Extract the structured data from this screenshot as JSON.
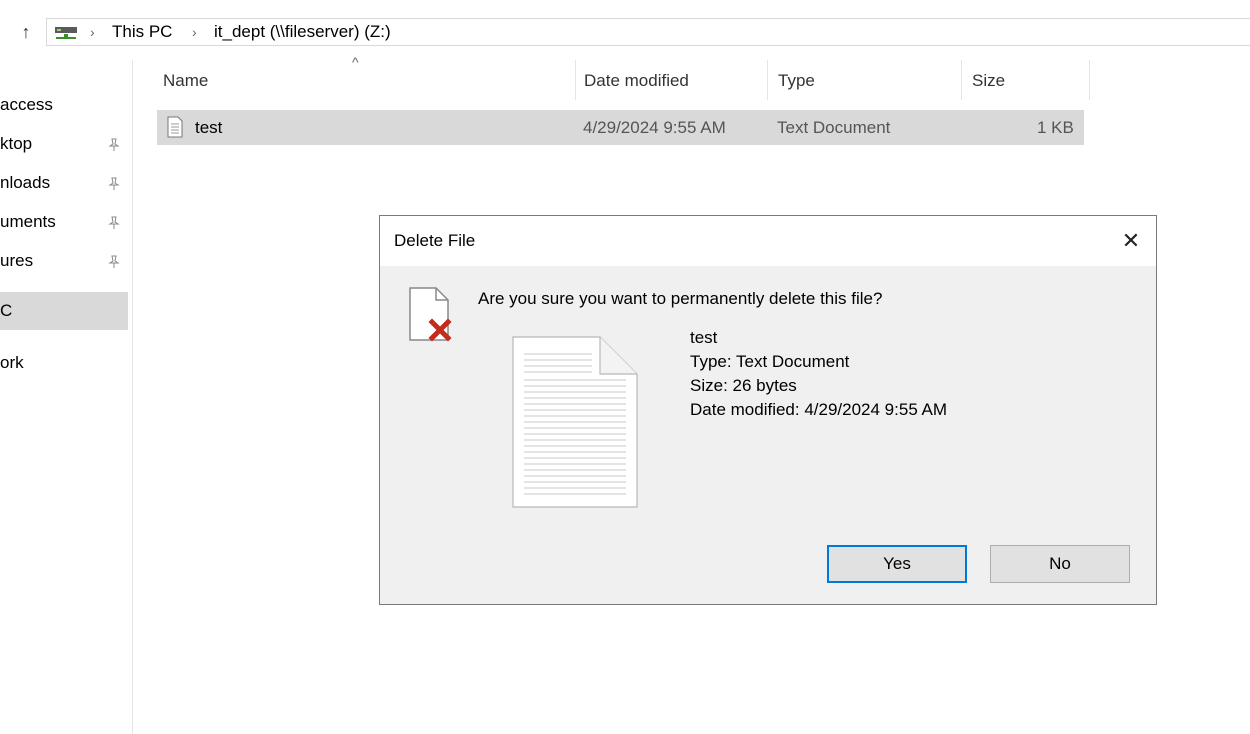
{
  "address": {
    "crumbs": [
      "This PC",
      "it_dept (\\\\fileserver) (Z:)"
    ],
    "separator": "›",
    "up_glyph": "↑"
  },
  "icons": {
    "up": "up-arrow-icon",
    "drive": "network-drive-icon",
    "pin": "pin-icon",
    "file": "text-file-icon",
    "delete": "delete-warning-icon",
    "close": "close-icon"
  },
  "sidebar": {
    "items": [
      {
        "label": "access",
        "pinned": false
      },
      {
        "label": "ktop",
        "pinned": true
      },
      {
        "label": "nloads",
        "pinned": true
      },
      {
        "label": "uments",
        "pinned": true
      },
      {
        "label": "ures",
        "pinned": true
      },
      {
        "label": "C",
        "pinned": false,
        "selected": true
      },
      {
        "label": "ork",
        "pinned": false
      }
    ],
    "pin_glyph": "📌"
  },
  "columns": {
    "name": "Name",
    "date": "Date modified",
    "type": "Type",
    "size": "Size",
    "sort_glyph": "^"
  },
  "files": [
    {
      "name": "test",
      "date": "4/29/2024 9:55 AM",
      "type": "Text Document",
      "size": "1 KB"
    }
  ],
  "dialog": {
    "title": "Delete File",
    "close_glyph": "✕",
    "question": "Are you sure you want to permanently delete this file?",
    "file_name": "test",
    "file_type": "Type: Text Document",
    "file_size": "Size: 26 bytes",
    "file_date": "Date modified: 4/29/2024 9:55 AM",
    "yes_label": "Yes",
    "no_label": "No"
  },
  "colors": {
    "selection": "#d9d9d9",
    "dialog_bg": "#f0f0f0",
    "accent": "#0078d7",
    "delete_x": "#c42b1c"
  }
}
